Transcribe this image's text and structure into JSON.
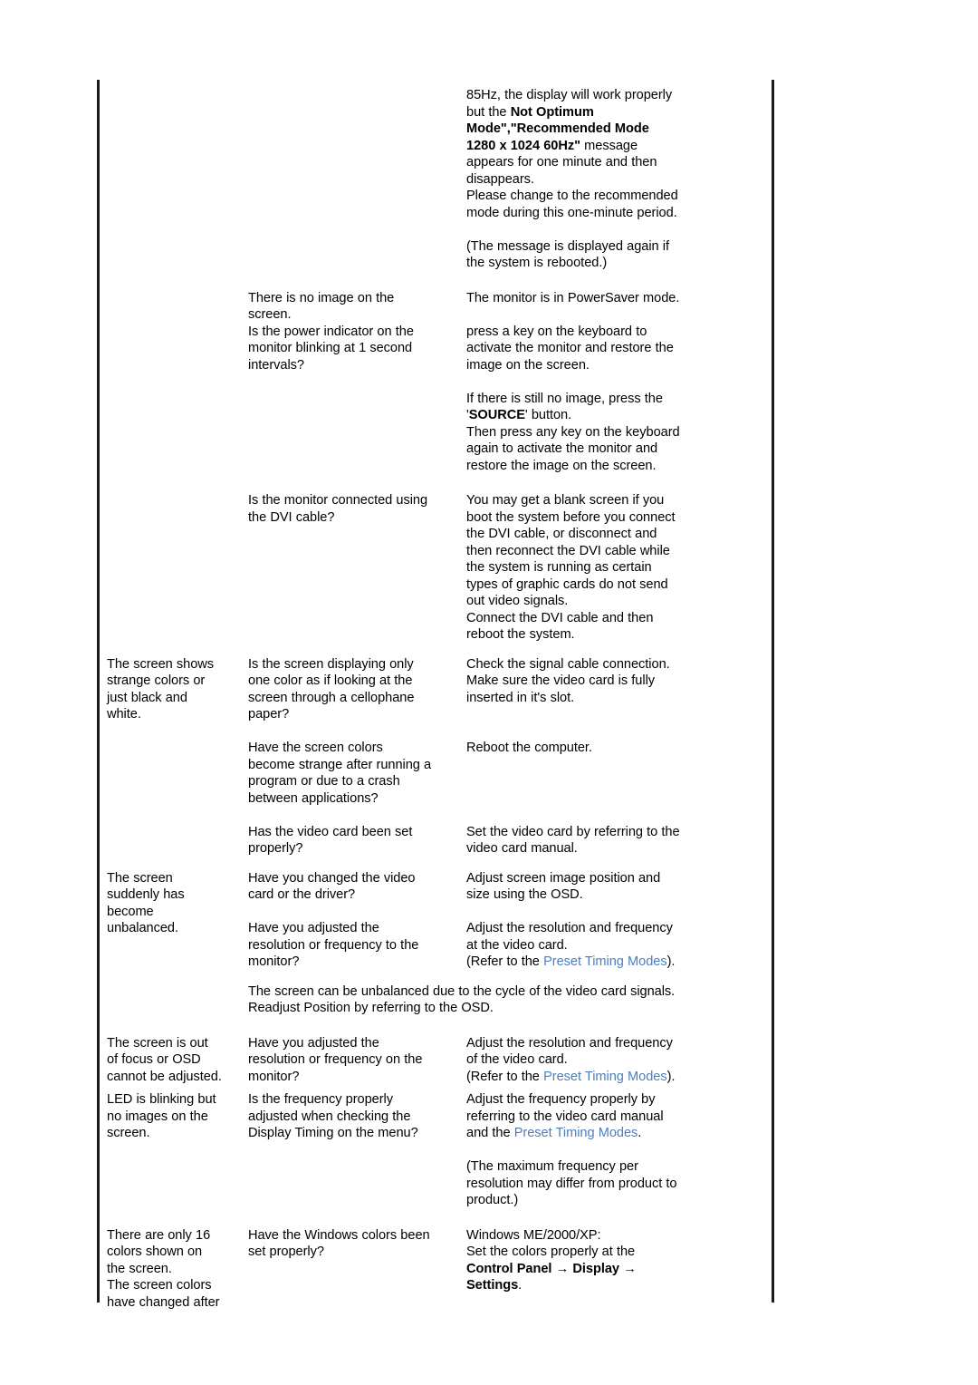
{
  "document": {
    "type": "troubleshooting-table",
    "link_color": "#4d7ebf",
    "link_label": "Preset Timing Modes"
  },
  "rows": [
    {
      "id": "not-optimum-mode",
      "symptom": "",
      "checklist": "",
      "solution_lines": [
        "85Hz, the display will work properly",
        "but the \"Not Optimum",
        "Mode\",\"Recommended Mode",
        "1280 x 1024 60Hz\" message",
        "appears for one minute and then",
        "disappears.",
        "Please change to the recommended",
        "mode during this one-minute period."
      ],
      "solution_lines_2": [
        "(The message is displayed again if",
        "the system is rebooted.)"
      ],
      "bold_fragments": [
        "Not Optimum",
        "Mode\",\"Recommended Mode",
        "1280 x 1024 60Hz\""
      ]
    },
    {
      "id": "no-image-powersaver",
      "symptom_lines": [
        "There is no image on the",
        "screen."
      ],
      "checklist_lines": [
        "Is the power indicator on the",
        "monitor blinking at 1 second",
        "intervals?"
      ],
      "solution_a": [
        "The monitor is in PowerSaver mode."
      ],
      "solution_b": [
        "press a key on the keyboard to",
        "activate the monitor and restore the",
        "image on the screen."
      ],
      "solution_c_pre": "If there is still no image, press the",
      "solution_c_bold": "SOURCE",
      "solution_c_post": "' button.",
      "solution_c_quote": "'",
      "solution_c_rest": [
        "Then press any key on the keyboard",
        "again to activate the monitor and",
        "restore the image on the screen."
      ]
    },
    {
      "id": "dvi-cable",
      "checklist_lines": [
        "Is the monitor connected using",
        "the DVI cable?"
      ],
      "solution_lines": [
        "You may get a blank screen if you",
        "boot the system before you connect",
        "the DVI cable, or disconnect and",
        "then reconnect the DVI cable while",
        "the system is running as certain",
        "types of graphic cards do not send",
        "out video signals.",
        "Connect the DVI cable and then",
        "reboot the system."
      ]
    },
    {
      "id": "strange-colors",
      "symptom_lines": [
        "The screen shows",
        "strange colors or",
        "just black and",
        "white."
      ],
      "sub": [
        {
          "checklist_lines": [
            "Is the screen displaying only",
            "one color as if looking at the",
            "screen through a cellophane",
            "paper?"
          ],
          "solution_lines": [
            "Check the signal cable connection.",
            "Make sure the video card is fully",
            "inserted in it's slot."
          ]
        },
        {
          "checklist_lines": [
            "Have the screen colors",
            "become strange after running a",
            "program or due to a crash",
            "between applications?"
          ],
          "solution_lines": [
            "Reboot the computer."
          ]
        },
        {
          "checklist_lines": [
            "Has the video card been set",
            "properly?"
          ],
          "solution_lines": [
            "Set the video card by referring to the",
            "video card manual."
          ]
        }
      ]
    },
    {
      "id": "unbalanced",
      "symptom_lines": [
        "The screen",
        "suddenly has",
        "become",
        "unbalanced."
      ],
      "sub": [
        {
          "checklist_lines": [
            "Have you changed the video",
            "card or the driver?"
          ],
          "solution_lines": [
            "Adjust screen image position and",
            "size using the OSD."
          ]
        },
        {
          "checklist_lines": [
            "Have you adjusted the",
            "resolution or frequency to the",
            "monitor?"
          ],
          "solution_lines": [
            "Adjust the resolution and frequency",
            "at the video card."
          ],
          "solution_link_pre": "(Refer to the ",
          "solution_link_text": "Preset Timing Modes",
          "solution_link_post": ")."
        }
      ],
      "note_lines": [
        "The screen can be unbalanced due to the cycle of the video card signals.",
        "Readjust Position by referring to the OSD."
      ]
    },
    {
      "id": "out-of-focus",
      "symptom_lines": [
        "The screen is out",
        "of focus or OSD",
        "cannot be adjusted."
      ],
      "checklist_lines": [
        "Have you adjusted the",
        "resolution or frequency on the",
        "monitor?"
      ],
      "solution_lines": [
        "Adjust the resolution and frequency",
        "of the video card."
      ],
      "solution_link_pre": "(Refer to the ",
      "solution_link_text": "Preset Timing Modes",
      "solution_link_post": ")."
    },
    {
      "id": "led-blinking",
      "symptom_lines": [
        "LED is blinking but",
        "no images on the",
        "screen."
      ],
      "checklist_lines": [
        "Is the frequency properly",
        "adjusted when checking the",
        "Display Timing on the menu?"
      ],
      "solution_lines": [
        "Adjust the frequency properly by",
        "referring to the video card manual"
      ],
      "solution_link_pre": "and the ",
      "solution_link_text": "Preset Timing Modes",
      "solution_link_post": ".",
      "solution_note": [
        "(The maximum frequency per",
        "resolution may differ from product to",
        "product.)"
      ]
    },
    {
      "id": "16-colors",
      "symptom_lines": [
        "There are only 16",
        "colors shown on",
        "the screen.",
        "The screen colors",
        "have changed after"
      ],
      "checklist_lines": [
        "Have the Windows colors been",
        "set properly?"
      ],
      "solution_lines": [
        "Windows ME/2000/XP:",
        "Set the colors properly at the"
      ],
      "solution_bold_1": "Control Panel",
      "arrow": "→",
      "solution_bold_2": "Display",
      "solution_bold_3": "Settings",
      "solution_tail": "."
    }
  ]
}
